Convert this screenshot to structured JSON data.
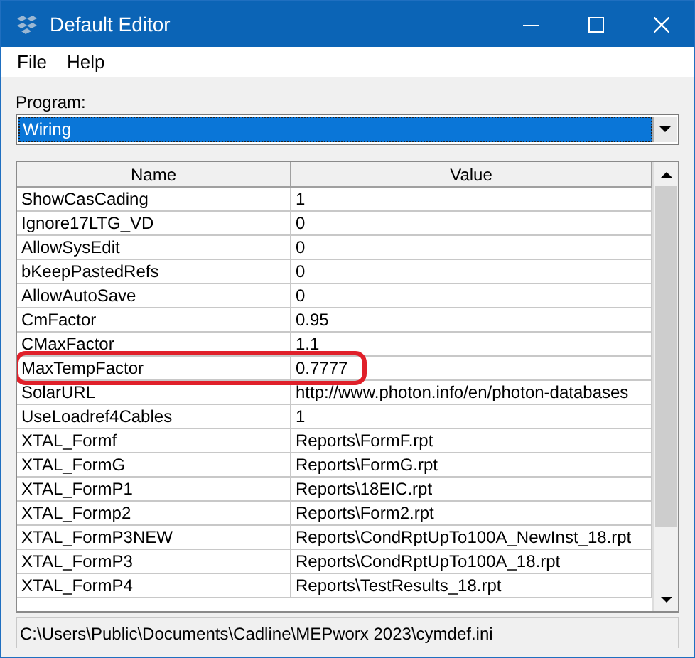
{
  "window": {
    "title": "Default Editor"
  },
  "menu": [
    "File",
    "Help"
  ],
  "program": {
    "label": "Program:",
    "value": "Wiring"
  },
  "table": {
    "columns": [
      "Name",
      "Value"
    ],
    "rows": [
      {
        "name": "ShowCasCading",
        "value": "1",
        "highlighted": false
      },
      {
        "name": "Ignore17LTG_VD",
        "value": "0",
        "highlighted": false
      },
      {
        "name": "AllowSysEdit",
        "value": "0",
        "highlighted": false
      },
      {
        "name": "bKeepPastedRefs",
        "value": "0",
        "highlighted": false
      },
      {
        "name": "AllowAutoSave",
        "value": "0",
        "highlighted": false
      },
      {
        "name": "CmFactor",
        "value": "0.95",
        "highlighted": false
      },
      {
        "name": "CMaxFactor",
        "value": "1.1",
        "highlighted": false
      },
      {
        "name": "MaxTempFactor",
        "value": "0.7777",
        "highlighted": true
      },
      {
        "name": "SolarURL",
        "value": "http://www.photon.info/en/photon-databases",
        "highlighted": false
      },
      {
        "name": "UseLoadref4Cables",
        "value": "1",
        "highlighted": false
      },
      {
        "name": "XTAL_Formf",
        "value": "Reports\\FormF.rpt",
        "highlighted": false
      },
      {
        "name": "XTAL_FormG",
        "value": "Reports\\FormG.rpt",
        "highlighted": false
      },
      {
        "name": "XTAL_FormP1",
        "value": "Reports\\18EIC.rpt",
        "highlighted": false
      },
      {
        "name": "XTAL_Formp2",
        "value": "Reports\\Form2.rpt",
        "highlighted": false
      },
      {
        "name": "XTAL_FormP3NEW",
        "value": "Reports\\CondRptUpTo100A_NewInst_18.rpt",
        "highlighted": false
      },
      {
        "name": "XTAL_FormP3",
        "value": "Reports\\CondRptUpTo100A_18.rpt",
        "highlighted": false
      },
      {
        "name": "XTAL_FormP4",
        "value": "Reports\\TestResults_18.rpt",
        "highlighted": false
      }
    ]
  },
  "status_bar": "C:\\Users\\Public\\Documents\\Cadline\\MEPworx 2023\\cymdef.ini"
}
